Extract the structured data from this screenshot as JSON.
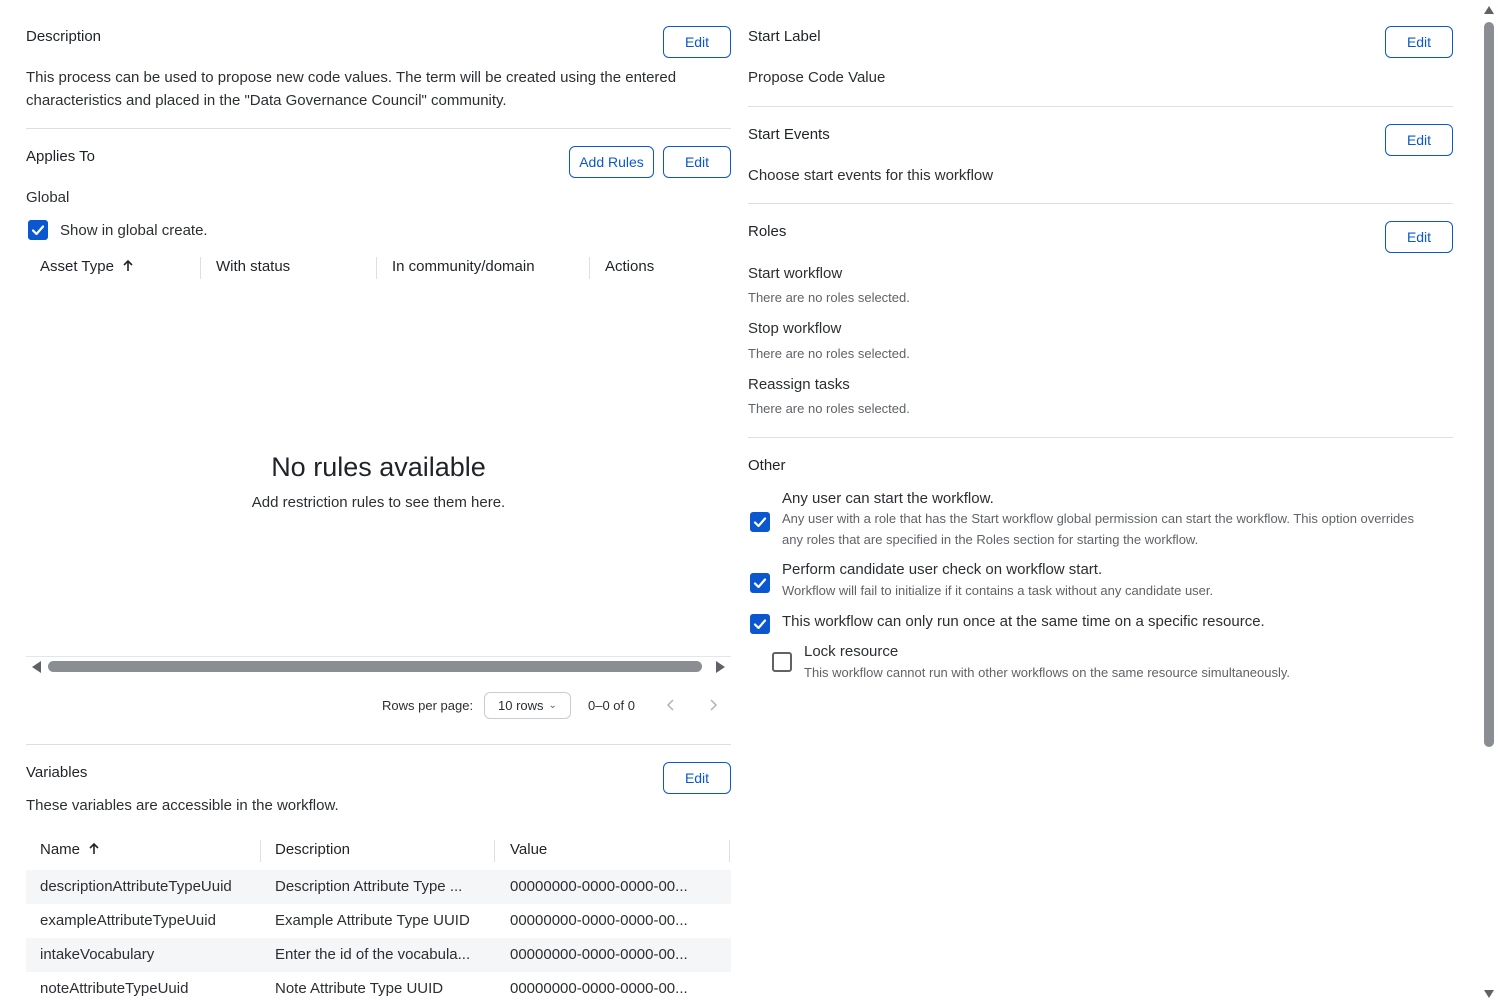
{
  "description": {
    "heading": "Description",
    "edit_label": "Edit",
    "text_line1": "This process can be used to propose new code values. The term will be created using the entered",
    "text_line2": "characteristics and placed in the \"Data Governance Council\" community."
  },
  "applies_to": {
    "heading": "Applies To",
    "add_rules_label": "Add Rules",
    "edit_label": "Edit",
    "scope": "Global",
    "show_global_create_label": "Show in global create.",
    "show_global_create_checked": true,
    "columns": [
      "Asset Type",
      "With status",
      "In community/domain",
      "Actions"
    ],
    "sort_icon": "arrow-up-icon",
    "empty_title": "No rules available",
    "empty_subtitle": "Add restriction rules to see them here.",
    "rows_per_page_label": "Rows per page:",
    "rows_per_page_value": "10 rows",
    "range_text": "0–0 of 0"
  },
  "variables": {
    "heading": "Variables",
    "edit_label": "Edit",
    "subtitle": "These variables are accessible in the workflow.",
    "columns": [
      "Name",
      "Description",
      "Value"
    ],
    "rows": [
      {
        "name": "descriptionAttributeTypeUuid",
        "description": "Description Attribute Type ...",
        "value": "00000000-0000-0000-00..."
      },
      {
        "name": "exampleAttributeTypeUuid",
        "description": "Example Attribute Type UUID",
        "value": "00000000-0000-0000-00..."
      },
      {
        "name": "intakeVocabulary",
        "description": "Enter the id of the vocabula...",
        "value": "00000000-0000-0000-00..."
      },
      {
        "name": "noteAttributeTypeUuid",
        "description": "Note Attribute Type UUID",
        "value": "00000000-0000-0000-00..."
      }
    ]
  },
  "start_label": {
    "heading": "Start Label",
    "edit_label": "Edit",
    "value": "Propose Code Value"
  },
  "start_events": {
    "heading": "Start Events",
    "edit_label": "Edit",
    "value": "Choose start events for this workflow"
  },
  "roles": {
    "heading": "Roles",
    "edit_label": "Edit",
    "items": [
      {
        "label": "Start workflow",
        "value": "There are no roles selected."
      },
      {
        "label": "Stop workflow",
        "value": "There are no roles selected."
      },
      {
        "label": "Reassign tasks",
        "value": "There are no roles selected."
      }
    ]
  },
  "other": {
    "heading": "Other",
    "options": [
      {
        "label": "Any user can start the workflow.",
        "help1": "Any user with a role that has the Start workflow global permission can start the workflow. This option overrides",
        "help2": "any roles that are specified in the Roles section for starting the workflow.",
        "checked": true
      },
      {
        "label": "Perform candidate user check on workflow start.",
        "help1": "Workflow will fail to initialize if it contains a task without any candidate user.",
        "checked": true
      },
      {
        "label": "This workflow can only run once at the same time on a specific resource.",
        "checked": true
      },
      {
        "label": "Lock resource",
        "help1": "This workflow cannot run with other workflows on the same resource simultaneously.",
        "checked": false
      }
    ]
  },
  "colors": {
    "accent": "#0b57d0",
    "divider": "#dcdfe3",
    "row_shade": "#f5f6f7"
  }
}
